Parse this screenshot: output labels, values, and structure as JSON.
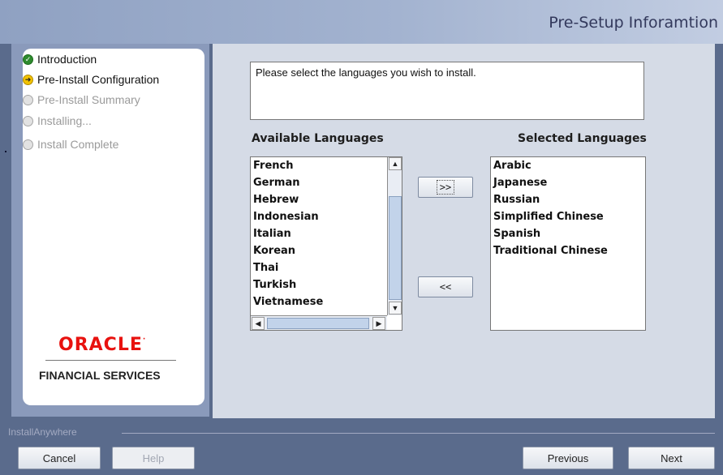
{
  "header": {
    "title": "Pre-Setup Inforamtion"
  },
  "steps": [
    {
      "label": "Introduction",
      "state": "done",
      "icon": "check-circle-icon"
    },
    {
      "label": "Pre-Install Configuration",
      "state": "current",
      "icon": "arrow-circle-icon"
    },
    {
      "label": "Pre-Install Summary",
      "state": "pending",
      "icon": "empty-circle-icon"
    },
    {
      "label": "Installing...",
      "state": "pending",
      "icon": "empty-circle-icon"
    },
    {
      "label": "Install Complete",
      "state": "pending",
      "icon": "empty-circle-icon"
    }
  ],
  "logo": {
    "brand": "ORACLE",
    "subtitle": "FINANCIAL SERVICES"
  },
  "content": {
    "description": "Please select the languages you wish to install.",
    "available_label": "Available Languages",
    "selected_label": "Selected Languages",
    "available": [
      "French",
      "German",
      "Hebrew",
      "Indonesian",
      "Italian",
      "Korean",
      "Thai",
      "Turkish",
      "Vietnamese"
    ],
    "selected": [
      "Arabic",
      "Japanese",
      "Russian",
      "Simplified Chinese",
      "Spanish",
      "Traditional Chinese"
    ],
    "add_button": ">>",
    "remove_button": "<<"
  },
  "footer": {
    "section_label": "InstallAnywhere",
    "cancel": "Cancel",
    "help": "Help",
    "previous": "Previous",
    "next": "Next"
  },
  "colors": {
    "accent": "#2e8b2e",
    "brand": "#e8120f",
    "current": "#f2c200"
  }
}
